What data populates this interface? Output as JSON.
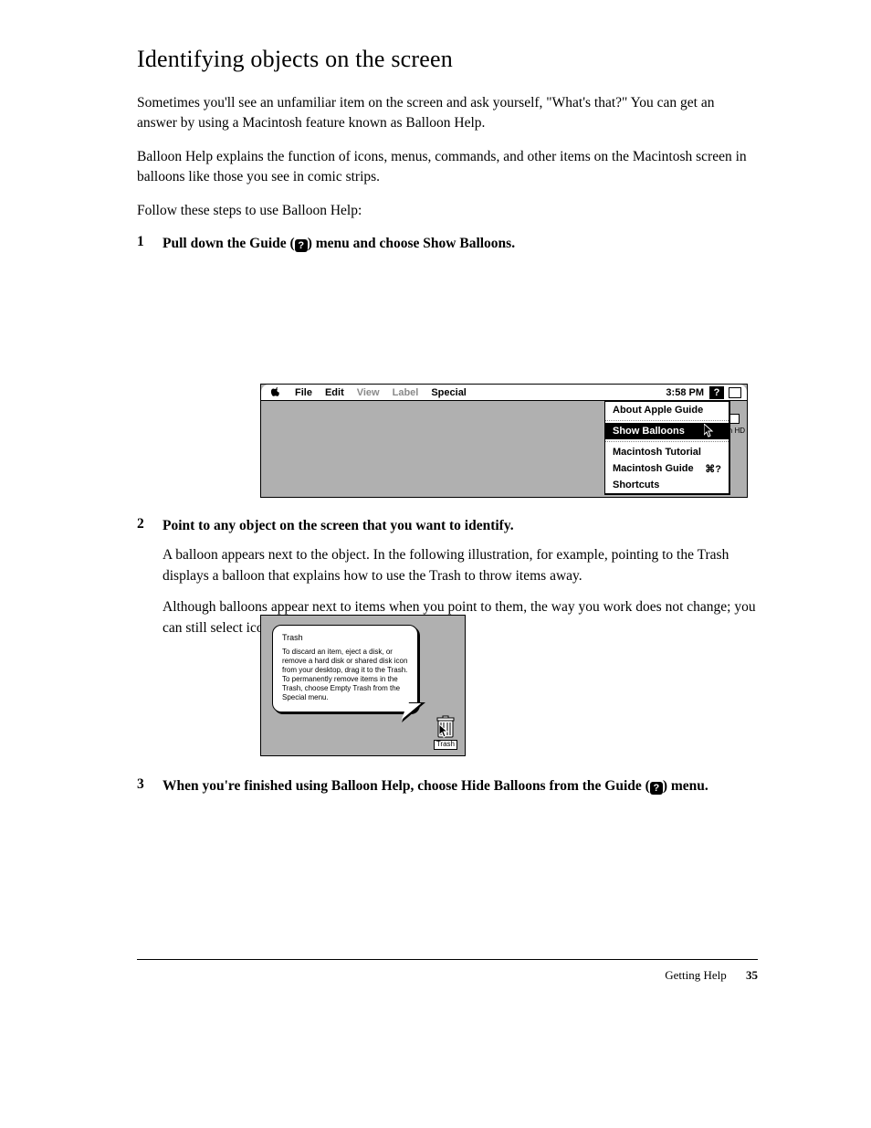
{
  "heading": "Identifying objects on the screen",
  "intro": [
    "Sometimes you'll see an unfamiliar item on the screen and ask yourself, \"What's that?\" You can get an answer by using a Macintosh feature known as Balloon Help.",
    "Balloon Help explains the function of icons, menus, commands, and other items on the Macintosh screen in balloons like those you see in comic strips.",
    "Follow these steps to use Balloon Help:"
  ],
  "step1": {
    "num": "1",
    "text_before": "Pull down the Guide (",
    "text_after": ") menu and choose Show Balloons."
  },
  "menubar": {
    "items": [
      {
        "label": "File",
        "dim": false
      },
      {
        "label": "Edit",
        "dim": false
      },
      {
        "label": "View",
        "dim": true
      },
      {
        "label": "Label",
        "dim": true
      },
      {
        "label": "Special",
        "dim": false
      }
    ],
    "clock": "3:58 PM"
  },
  "helpmenu": {
    "items": [
      {
        "label": "About Apple Guide"
      },
      {
        "sep": true
      },
      {
        "label": "Show Balloons",
        "selected": true
      },
      {
        "sep": true
      },
      {
        "label": "Macintosh Tutorial"
      },
      {
        "label": "Macintosh Guide",
        "kb": "⌘?"
      },
      {
        "label": "Shortcuts"
      }
    ]
  },
  "disk_label": "sh HD",
  "step2": {
    "num": "2",
    "text": "Point to any object on the screen that you want to identify.",
    "after": "A balloon appears next to the object. In the following illustration, for example, pointing to the Trash displays a balloon that explains how to use the Trash to throw items away.",
    "after2": "Although balloons appear next to items when you point to them, the way you work does not change; you can still select icons, choose commands, and so on."
  },
  "balloon": {
    "title": "Trash",
    "body": "To discard an item, eject a disk, or remove a hard disk or shared disk icon from your desktop, drag it to the Trash. To permanently remove items in the Trash, choose Empty Trash from the Special menu."
  },
  "trash_label": "Trash",
  "step3": {
    "num": "3",
    "text_before": "When you're finished using Balloon Help, choose Hide Balloons from the Guide (",
    "text_after": ") menu."
  },
  "footer": {
    "label": "Getting Help",
    "page": "35"
  }
}
